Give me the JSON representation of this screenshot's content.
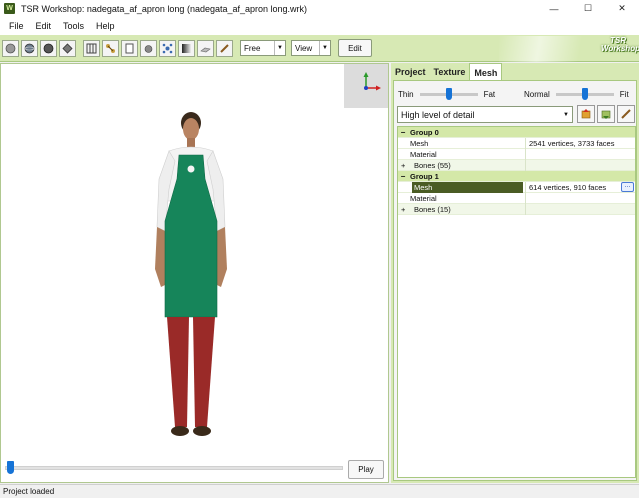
{
  "window": {
    "title": "TSR Workshop: nadegata_af_apron long (nadegata_af_apron long.wrk)",
    "app_icon_text": "W",
    "controls": [
      "—",
      "☐",
      "✕"
    ]
  },
  "menu": [
    "File",
    "Edit",
    "Tools",
    "Help"
  ],
  "toolbar": {
    "mode_select": "Free",
    "view_select": "View",
    "edit_label": "Edit",
    "logo_text": [
      "TSR",
      "Workshop"
    ]
  },
  "viewport": {
    "timeline_position": 0.0,
    "play_label": "Play"
  },
  "panel": {
    "tabs": [
      "Project",
      "Texture",
      "Mesh"
    ],
    "active_tab": "Mesh",
    "thin_label": "Thin",
    "fat_label": "Fat",
    "thin_fat_value": 0.5,
    "normal_label": "Normal",
    "fit_label": "Fit",
    "normal_fit_value": 0.5,
    "lod_select": "High level of detail",
    "groups": [
      {
        "name": "Group 0",
        "rows": [
          {
            "label": "Mesh",
            "value": "2541 vertices, 3733 faces"
          },
          {
            "label": "Material",
            "value": ""
          },
          {
            "label": "Bones (55)",
            "value": ""
          }
        ]
      },
      {
        "name": "Group 1",
        "rows": [
          {
            "label": "Mesh",
            "value": "614 vertices, 910 faces"
          },
          {
            "label": "Material",
            "value": ""
          },
          {
            "label": "Bones (15)",
            "value": ""
          }
        ]
      }
    ],
    "more_button": "..."
  },
  "status": "Project loaded"
}
